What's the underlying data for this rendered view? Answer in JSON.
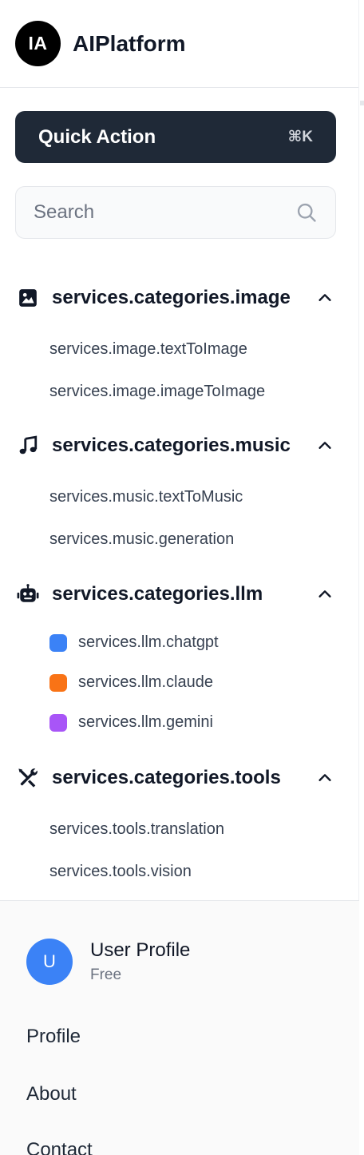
{
  "app": {
    "logo_initials": "IA",
    "name": "AIPlatform"
  },
  "quick_action": {
    "label": "Quick Action",
    "shortcut": "⌘K"
  },
  "search": {
    "placeholder": "Search",
    "value": ""
  },
  "categories": [
    {
      "label": "services.categories.image",
      "icon": "image-icon",
      "expanded": true,
      "items": [
        "services.image.textToImage",
        "services.image.imageToImage"
      ]
    },
    {
      "label": "services.categories.music",
      "icon": "music-note-icon",
      "expanded": true,
      "items": [
        "services.music.textToMusic",
        "services.music.generation"
      ]
    },
    {
      "label": "services.categories.llm",
      "icon": "robot-icon",
      "expanded": true,
      "items": [
        {
          "label": "services.llm.chatgpt",
          "color": "#3b82f6"
        },
        {
          "label": "services.llm.claude",
          "color": "#f97316"
        },
        {
          "label": "services.llm.gemini",
          "color": "#a855f7"
        }
      ]
    },
    {
      "label": "services.categories.tools",
      "icon": "tools-icon",
      "expanded": true,
      "items": [
        "services.tools.translation",
        "services.tools.vision"
      ]
    }
  ],
  "user": {
    "initial": "U",
    "name": "User Profile",
    "plan": "Free",
    "avatar_color": "#3b82f6"
  },
  "footer_links": [
    "Profile",
    "About",
    "Contact"
  ],
  "colors": {
    "quick_action_bg": "#1f2937",
    "logo_bg": "#000000"
  }
}
